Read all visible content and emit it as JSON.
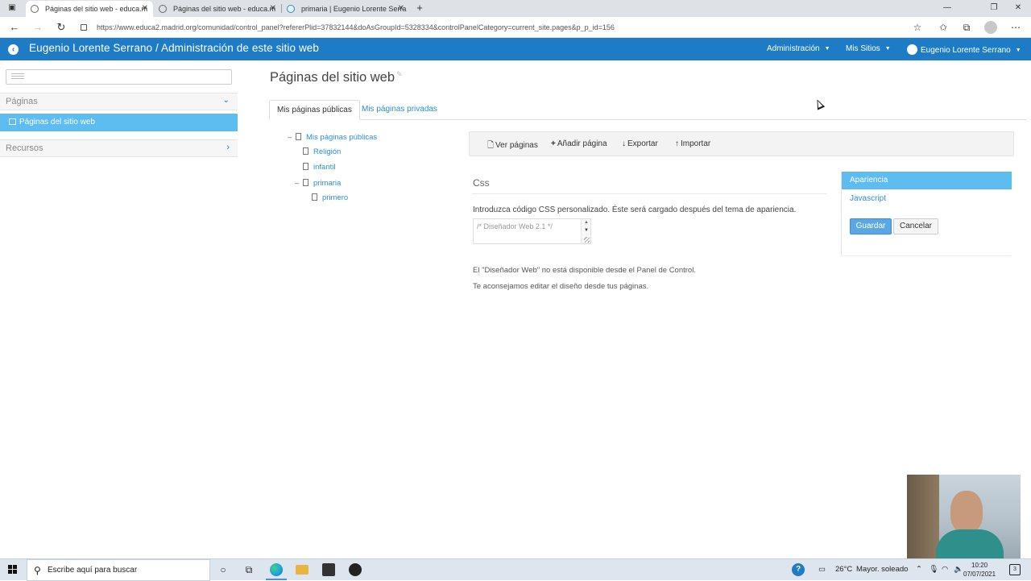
{
  "browser": {
    "tabs": [
      {
        "title": "Páginas del sitio web - educa.m",
        "active": true
      },
      {
        "title": "Páginas del sitio web - educa.m",
        "active": false
      },
      {
        "title": "primaria | Eugenio Lorente Serra",
        "active": false
      }
    ],
    "url": "https://www.educa2.madrid.org/comunidad/control_panel?refererPlid=37832144&doAsGroupId=5328334&controlPanelCategory=current_site.pages&p_p_id=156"
  },
  "topbar": {
    "title": "Eugenio Lorente Serrano / Administración de este sitio web",
    "menu_admin": "Administración",
    "menu_sites": "Mis Sitios",
    "menu_user": "Eugenio Lorente Serrano"
  },
  "sidebar": {
    "section_pages": "Páginas",
    "active_item": "Páginas del sitio web",
    "section_resources": "Recursos"
  },
  "main": {
    "title": "Páginas del sitio web",
    "tab_public": "Mis páginas públicas",
    "tab_private": "Mis páginas privadas",
    "tree": {
      "root": "Mis páginas públicas",
      "religion": "Religión",
      "infantil": "infantil",
      "primaria": "primaria",
      "primero": "primero"
    },
    "toolbar": {
      "view": "Ver páginas",
      "add": "Añadir página",
      "export": "Exportar",
      "import": "Importar"
    },
    "css_heading": "Css",
    "css_description": "Introduzca código CSS personalizado. Éste será cargado después del tema de apariencia.",
    "css_placeholder": "/* Diseñador Web 2.1 */",
    "note_line1": "El \"Diseñador Web\" no está disponible desde el Panel de Control.",
    "note_line2": "Te aconsejamos editar el diseño desde tus páginas.",
    "right_nav": {
      "active": "Apariencia",
      "javascript": "Javascript"
    },
    "save_label": "Guardar",
    "cancel_label": "Cancelar"
  },
  "taskbar": {
    "search_placeholder": "Escribe aquí para buscar",
    "weather_temp": "26°C",
    "weather_text": "Mayor. soleado",
    "time": "10:20",
    "date": "07/07/2021",
    "notif_count": "3"
  },
  "colors": {
    "topbar": "#1e7cc7",
    "active_highlight": "#5dbcf0",
    "link": "#2b8fd4",
    "primary_button": "#5aa7e6"
  },
  "icons": [
    "browser-tab-menu-icon",
    "favicon-icon",
    "close-icon",
    "new-tab-icon",
    "back-arrow-icon",
    "forward-arrow-icon",
    "reload-icon",
    "lock-icon",
    "favorites-icon",
    "collections-icon",
    "profile-icon",
    "more-icon",
    "chevron-down-icon",
    "chevron-right-icon",
    "document-icon",
    "plus-icon",
    "download-icon",
    "upload-icon",
    "windows-start-icon",
    "search-icon",
    "cortana-icon",
    "task-view-icon",
    "edge-icon",
    "folder-icon",
    "app-icon",
    "obs-icon",
    "help-icon"
  ]
}
